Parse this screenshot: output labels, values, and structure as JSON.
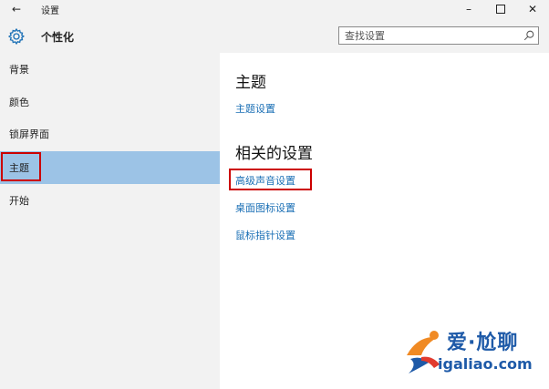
{
  "window": {
    "back_glyph": "←",
    "title": "设置",
    "min_glyph": "–",
    "close_glyph": "✕"
  },
  "header": {
    "page_title": "个性化",
    "search_placeholder": "查找设置"
  },
  "sidebar": {
    "items": [
      {
        "label": "背景"
      },
      {
        "label": "颜色"
      },
      {
        "label": "锁屏界面"
      },
      {
        "label": "主题",
        "selected": true
      },
      {
        "label": "开始"
      }
    ]
  },
  "main": {
    "section1_title": "主题",
    "theme_settings_link": "主题设置",
    "section2_title": "相关的设置",
    "links": [
      "高级声音设置",
      "桌面图标设置",
      "鼠标指针设置"
    ]
  },
  "watermark": {
    "top_text": "爱·尬聊",
    "bottom_text": "igaliao.com"
  },
  "colors": {
    "chrome_bg": "#f2f2f2",
    "selected_bg": "#9cc3e6",
    "link": "#1a6fb5",
    "highlight_box": "#cc0000",
    "accent_icon": "#1a6fb5"
  }
}
